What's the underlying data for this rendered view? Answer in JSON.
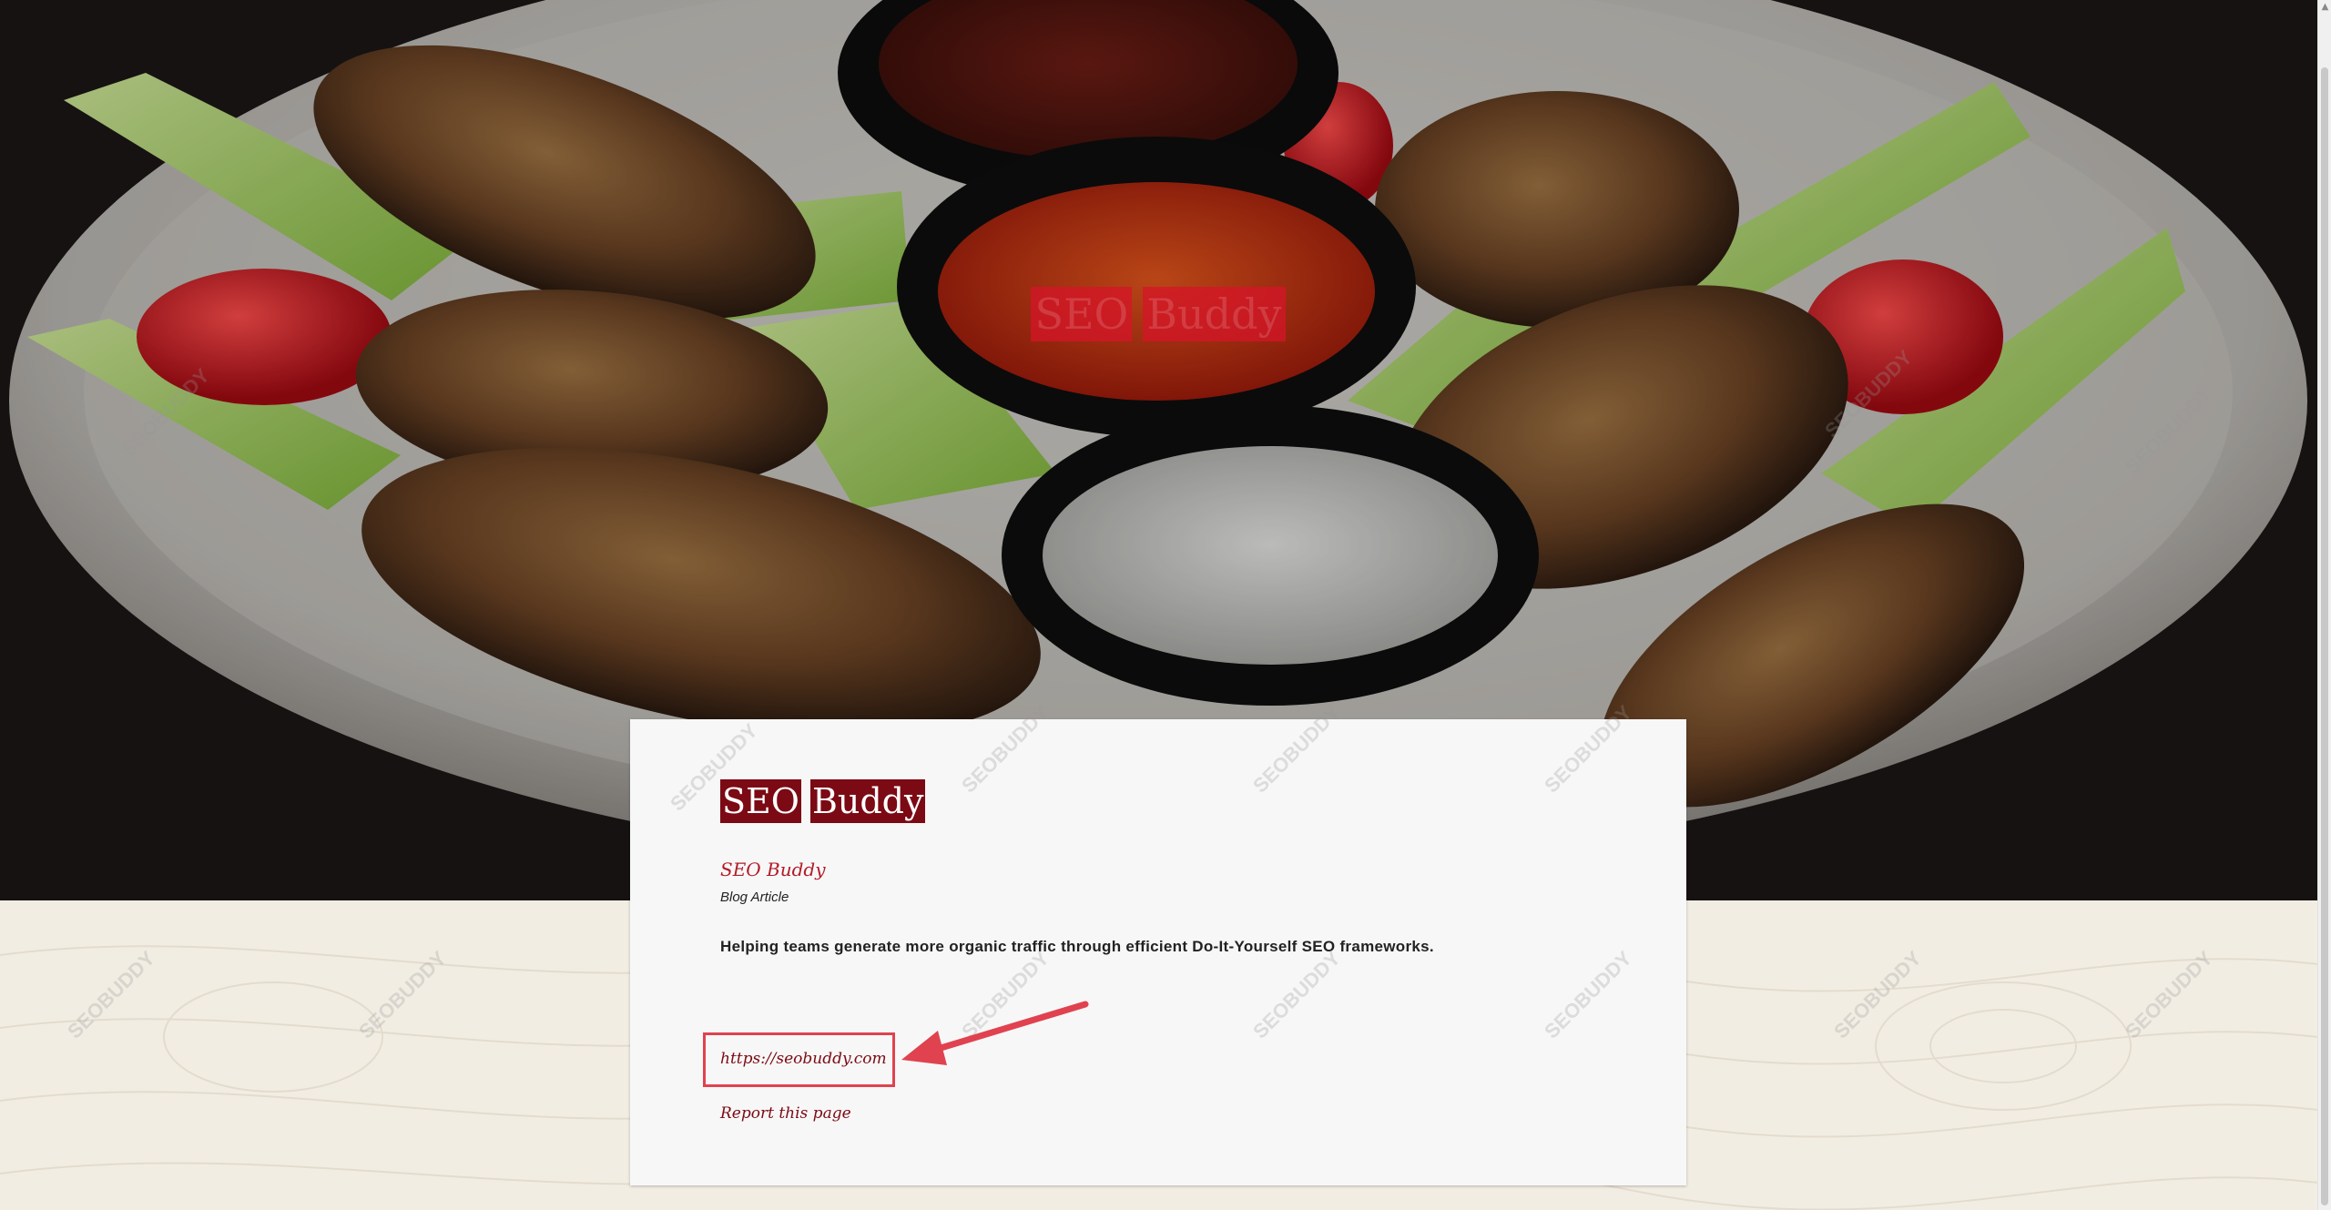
{
  "hero": {
    "overlay_title_words": [
      "SEO",
      "Buddy"
    ]
  },
  "card": {
    "title_words": [
      "SEO",
      "Buddy"
    ],
    "author": "SEO Buddy",
    "article_type": "Blog Article",
    "description": "Helping teams generate more organic traffic through efficient Do-It-Yourself SEO frameworks.",
    "site_link": "https://seobuddy.com",
    "report_link": "Report this page"
  },
  "watermark_text": "SEOBUDDY",
  "colors": {
    "title_bg": "#7b0a14",
    "link": "#7b0a14",
    "author": "#b31b28",
    "annotation": "#e0424f"
  }
}
